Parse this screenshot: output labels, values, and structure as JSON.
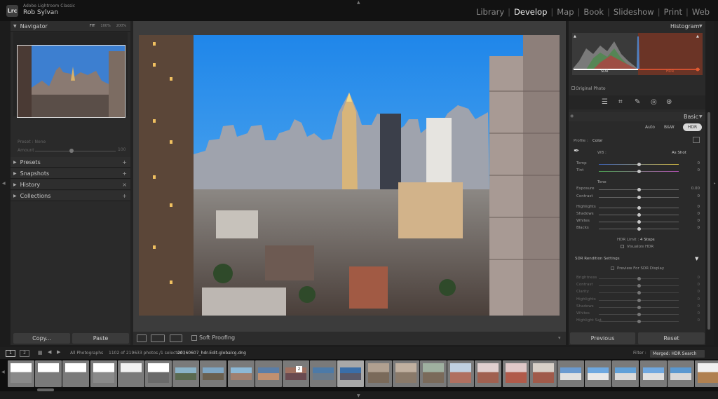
{
  "app": {
    "logo": "Lrc",
    "name": "Adobe Lightroom Classic",
    "user": "Rob Sylvan"
  },
  "modules": [
    {
      "label": "Library",
      "active": false
    },
    {
      "label": "Develop",
      "active": true
    },
    {
      "label": "Map",
      "active": false
    },
    {
      "label": "Book",
      "active": false
    },
    {
      "label": "Slideshow",
      "active": false
    },
    {
      "label": "Print",
      "active": false
    },
    {
      "label": "Web",
      "active": false
    }
  ],
  "module_separator": "|",
  "left": {
    "navigator": {
      "title": "Navigator",
      "zoom": [
        "FIT",
        "100%",
        "200%"
      ]
    },
    "preset": {
      "label": "Preset : None",
      "amount_label": "Amount",
      "amount_value": "100",
      "amount_fraction": 0.52
    },
    "panels": [
      {
        "label": "Presets",
        "action": "+"
      },
      {
        "label": "Snapshots",
        "action": "+"
      },
      {
        "label": "History",
        "action": "×"
      },
      {
        "label": "Collections",
        "action": "+"
      }
    ],
    "copy_label": "Copy...",
    "paste_label": "Paste"
  },
  "center": {
    "soft_proofing": "Soft Proofing",
    "view_icons": [
      "loupe-view-icon",
      "compare-icon",
      "before-after-icon"
    ]
  },
  "right": {
    "histogram": {
      "title": "Histogram",
      "sdr_label": "SDR",
      "hdr_label": "HDR",
      "original_photo": "Original Photo"
    },
    "tools": [
      "sliders-icon",
      "crop-icon",
      "healing-icon",
      "redeye-icon",
      "masking-icon"
    ],
    "basic": {
      "title": "Basic",
      "treatments": [
        "Auto",
        "B&W",
        "HDR"
      ],
      "profile_label": "Profile :",
      "profile_value": "Color",
      "wb_label": "WB :",
      "wb_value": "As Shot",
      "tone_heading": "Tone",
      "sliders": [
        {
          "label": "Temp",
          "value": "0",
          "pos": 0.5
        },
        {
          "label": "Tint",
          "value": "0",
          "pos": 0.5
        },
        {
          "label": "Exposure",
          "value": "0.00",
          "pos": 0.5
        },
        {
          "label": "Contrast",
          "value": "0",
          "pos": 0.5
        },
        {
          "label": "Highlights",
          "value": "0",
          "pos": 0.5
        },
        {
          "label": "Shadows",
          "value": "0",
          "pos": 0.5
        },
        {
          "label": "Whites",
          "value": "0",
          "pos": 0.5
        },
        {
          "label": "Blacks",
          "value": "0",
          "pos": 0.5
        }
      ],
      "hdr_limit_label": "HDR Limit :",
      "hdr_limit_value": "4 Stops",
      "visualize_hdr": "Visualize HDR",
      "sdr_settings_title": "SDR Rendition Settings",
      "preview_sdr": "Preview For SDR Display",
      "sdr_sliders": [
        {
          "label": "Brightness",
          "value": "0",
          "pos": 0.5
        },
        {
          "label": "Contrast",
          "value": "0",
          "pos": 0.5
        },
        {
          "label": "Clarity",
          "value": "0",
          "pos": 0.5
        },
        {
          "label": "Highlights",
          "value": "0",
          "pos": 0.5
        },
        {
          "label": "Shadows",
          "value": "0",
          "pos": 0.5
        },
        {
          "label": "Whites",
          "value": "0",
          "pos": 0.5
        },
        {
          "label": "Highlight Sat.",
          "value": "0",
          "pos": 0.5
        }
      ]
    },
    "previous_label": "Previous",
    "reset_label": "Reset"
  },
  "filmstrip": {
    "source": "All Photographs",
    "count": "1102 of 219633 photos /1 selected /",
    "filename": "20160607_hdr-Edit-globalcg.dng",
    "filter_label": "Filter :",
    "filter_value": "Merged: HDR Search",
    "screen_buttons": [
      "1",
      "2"
    ],
    "badge": "2"
  }
}
